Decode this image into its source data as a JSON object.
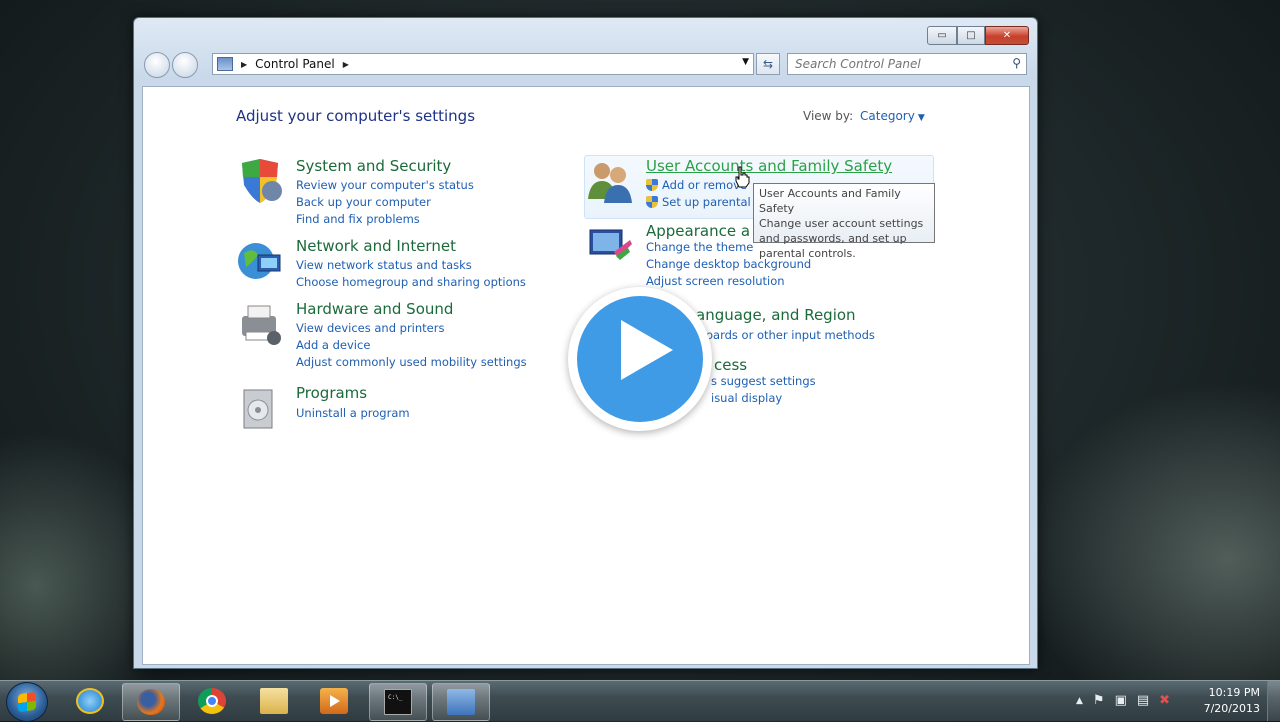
{
  "window": {
    "address_path": "Control Panel",
    "search_placeholder": "Search Control Panel",
    "caption": {
      "minimize": "▭",
      "maximize": "□",
      "close": "✕"
    }
  },
  "header": {
    "heading": "Adjust your computer's settings",
    "view_by_label": "View by:",
    "view_by_value": "Category"
  },
  "categories_left": [
    {
      "title": "System and Security",
      "links": [
        "Review your computer's status",
        "Back up your computer",
        "Find and fix problems"
      ],
      "icon": "shield-icon"
    },
    {
      "title": "Network and Internet",
      "links": [
        "View network status and tasks",
        "Choose homegroup and sharing options"
      ],
      "icon": "globe-network-icon"
    },
    {
      "title": "Hardware and Sound",
      "links": [
        "View devices and printers",
        "Add a device",
        "Adjust commonly used mobility settings"
      ],
      "icon": "printer-icon"
    },
    {
      "title": "Programs",
      "links": [
        "Uninstall a program"
      ],
      "icon": "programs-icon"
    }
  ],
  "categories_right": [
    {
      "title": "User Accounts and Family Safety",
      "links": [
        "Add or remove",
        "Set up parental"
      ],
      "icon": "users-icon"
    },
    {
      "title": "Appearance a",
      "links": [
        "Change the theme",
        "Change desktop background",
        "Adjust screen resolution"
      ],
      "icon": "appearance-icon"
    },
    {
      "title": "anguage, and Region",
      "links": [
        "oards or other input methods"
      ],
      "icon": "clock-language-icon"
    },
    {
      "title": "cess",
      "links": [
        "s suggest settings",
        "isual display"
      ],
      "icon": "ease-of-access-icon"
    }
  ],
  "tooltip": {
    "title": "User Accounts and Family Safety",
    "body": "Change user account settings and passwords, and set up parental controls."
  },
  "taskbar": {
    "clock_time": "10:19 PM",
    "clock_date": "7/20/2013",
    "items": [
      "internet-explorer-icon",
      "firefox-icon",
      "chrome-icon",
      "explorer-folder-icon",
      "media-player-icon",
      "command-prompt-icon",
      "control-panel-icon"
    ],
    "tray_glyphs": {
      "up": "▲",
      "flag": "⚑",
      "device": "▣",
      "network": "▤",
      "volume": "✖"
    }
  }
}
